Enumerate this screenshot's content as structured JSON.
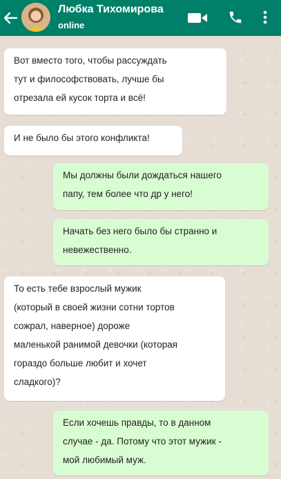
{
  "header": {
    "contact_name": "Любка Тихомирова",
    "status": "online",
    "accent_color": "#008069"
  },
  "icons": {
    "back": "arrow-left-icon",
    "video": "video-camera-icon",
    "call": "phone-icon",
    "menu": "more-vertical-icon"
  },
  "messages": [
    {
      "direction": "incoming",
      "text": "Вот вместо того, чтобы рассуждать\nтут и философствовать, лучше бы\nотрезала ей кусок торта и всё!"
    },
    {
      "direction": "incoming",
      "text": "И не было бы этого конфликта!"
    },
    {
      "direction": "outgoing",
      "text": "Мы должны были дождаться нашего\nпапу, тем более что др у него!"
    },
    {
      "direction": "outgoing",
      "text": "Начать без него было бы странно и\nневежественно."
    },
    {
      "direction": "incoming",
      "text": "То есть тебе взрослый мужик\n(который в своей жизни сотни тортов\nсожрал, наверное) дороже\nмаленькой ранимой девочки (которая\nгораздо больше любит и хочет\nсладкого)?"
    },
    {
      "direction": "outgoing",
      "text": "Если хочешь правды, то в данном\nслучае - да. Потому что этот мужик -\nмой любимый муж."
    }
  ]
}
